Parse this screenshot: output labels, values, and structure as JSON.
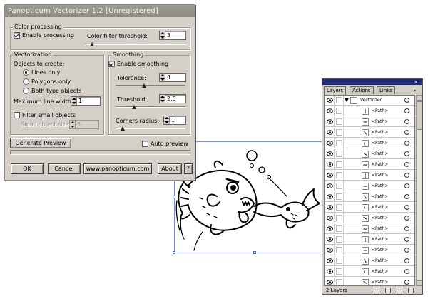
{
  "dialog": {
    "title": "Panopticum Vectorizer 1.2 [Unregistered]",
    "color_processing": {
      "group_label": "Color processing",
      "enable_label": "Enable processing",
      "enable_checked": true,
      "threshold_label": "Color filter threshold:",
      "threshold_value": "3",
      "slider_level": 0.05
    },
    "vectorization": {
      "group_label": "Vectorization",
      "objects_label": "Objects to create:",
      "options": [
        "Lines only",
        "Polygons only",
        "Both type objects"
      ],
      "selected_option": 0,
      "max_line_label": "Maximum line width:",
      "max_line_value": "1",
      "filter_label": "Filter small objects",
      "filter_checked": false,
      "small_size_label": "Small object size:",
      "small_size_value": "5"
    },
    "smoothing": {
      "group_label": "Smoothing",
      "enable_label": "Enable smoothing",
      "enable_checked": true,
      "tolerance_label": "Tolerance:",
      "tolerance_value": "4",
      "tolerance_level": 0.4,
      "threshold_label": "Threshold:",
      "threshold_value": "2,5",
      "threshold_level": 0.25,
      "corners_label": "Corners radius:",
      "corners_value": "1",
      "corners_level": 0.08
    },
    "generate_label": "Generate Preview",
    "auto_preview_label": "Auto preview",
    "auto_preview_checked": false,
    "buttons": {
      "ok": "OK",
      "cancel": "Cancel",
      "site": "www.panopticum.com",
      "about": "About",
      "help": "?"
    }
  },
  "layers_palette": {
    "tabs": [
      "Layers",
      "Actions",
      "Links"
    ],
    "active_tab": 0,
    "close_glyph": "×",
    "menu_glyph": "▸",
    "top_layer": "Vectorized",
    "path_label": "<Path>",
    "path_count": 18,
    "footer_count": "2 Layers"
  },
  "colors": {
    "dialog_bg": "#d4d0c8",
    "title_bar": "#8e8c86",
    "palette_title": "#1a2a78",
    "selection": "#6b8fd6"
  },
  "icons": [
    "checkmark-icon",
    "radio-icon",
    "spinner-icon",
    "eye-icon",
    "lock-icon",
    "disclosure-triangle-icon",
    "target-icon",
    "new-layer-icon",
    "trash-icon",
    "scroll-up-icon",
    "scroll-down-icon"
  ]
}
